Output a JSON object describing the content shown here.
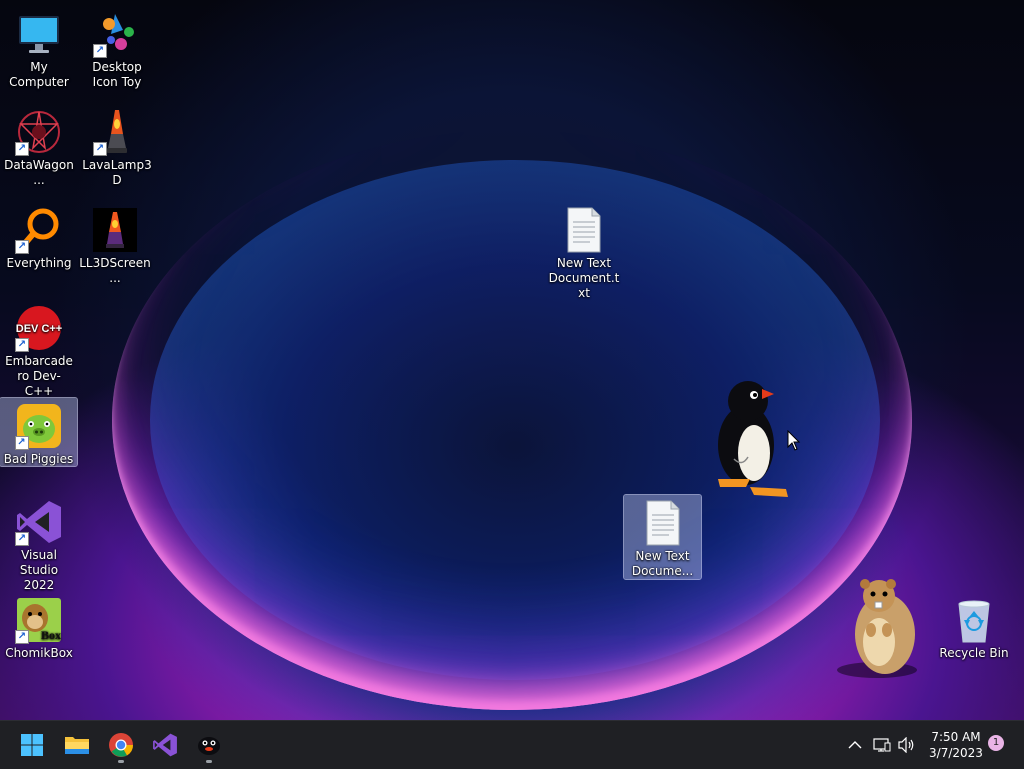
{
  "desktop_icons": [
    {
      "name": "my-computer",
      "label": "My Computer"
    },
    {
      "name": "desktop-icon-toy",
      "label": "Desktop Icon Toy"
    },
    {
      "name": "datawagon",
      "label": "DataWagon..."
    },
    {
      "name": "lavalamp3d",
      "label": "LavaLamp3D"
    },
    {
      "name": "everything",
      "label": "Everything"
    },
    {
      "name": "ll3dscreen",
      "label": "LL3DScreen..."
    },
    {
      "name": "new-text-document-txt",
      "label": "New Text Document.txt"
    },
    {
      "name": "embarcadero-devcpp",
      "label": "Embarcadero Dev-C++"
    },
    {
      "name": "bad-piggies",
      "label": "Bad Piggies"
    },
    {
      "name": "new-text-document-selected",
      "label": "New Text Docume..."
    },
    {
      "name": "visual-studio-2022",
      "label": "Visual Studio 2022"
    },
    {
      "name": "chomikbox",
      "label": "ChomikBox"
    },
    {
      "name": "recycle-bin",
      "label": "Recycle Bin"
    }
  ],
  "icon_text": {
    "devcpp": "DEV C++",
    "chomikbox": "Box"
  },
  "taskbar": {
    "apps": [
      {
        "name": "start",
        "icon": "windows-logo-icon"
      },
      {
        "name": "file-explorer",
        "icon": "folder-icon"
      },
      {
        "name": "chrome",
        "icon": "chrome-icon"
      },
      {
        "name": "visual-studio",
        "icon": "visual-studio-icon"
      },
      {
        "name": "pingu",
        "icon": "pingu-icon"
      }
    ],
    "clock": {
      "time": "7:50 AM",
      "date": "3/7/2023"
    },
    "notification_count": "1"
  },
  "colors": {
    "taskbar_bg": "#1f2024",
    "accent": "#0078d4",
    "selection": "#b4bee6"
  }
}
